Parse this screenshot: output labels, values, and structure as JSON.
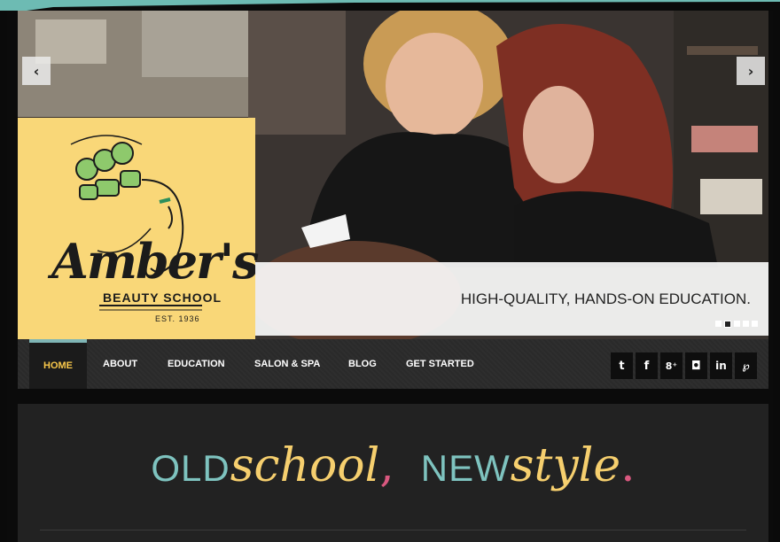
{
  "slider": {
    "prev_arrow": "‹",
    "next_arrow": "›",
    "caption": "HIGH-QUALITY, HANDS-ON EDUCATION.",
    "dots_count": 5,
    "active_dot": 2
  },
  "logo": {
    "script_text": "Amber's",
    "school_text": "BEAUTY SCHOOL",
    "est_text": "EST. 1936",
    "panel_color": "#f9d778"
  },
  "nav": {
    "items": [
      {
        "label": "HOME",
        "active": true
      },
      {
        "label": "ABOUT",
        "active": false
      },
      {
        "label": "EDUCATION",
        "active": false
      },
      {
        "label": "SALON & SPA",
        "active": false
      },
      {
        "label": "BLOG",
        "active": false
      },
      {
        "label": "GET STARTED",
        "active": false
      }
    ],
    "active_color": "#f9c84a",
    "accent_color": "#7fb5b5"
  },
  "social": [
    {
      "name": "twitter-icon",
      "glyph": "t"
    },
    {
      "name": "facebook-icon",
      "glyph": "f"
    },
    {
      "name": "google-plus-icon",
      "glyph": "8⁺"
    },
    {
      "name": "instagram-icon",
      "glyph": "◘"
    },
    {
      "name": "linkedin-icon",
      "glyph": "in"
    },
    {
      "name": "pinterest-icon",
      "glyph": "℘"
    }
  ],
  "tagline": {
    "old": "OLD",
    "school": "school",
    "comma": ",",
    "new": "NEW",
    "style": "style",
    "dot": "."
  }
}
